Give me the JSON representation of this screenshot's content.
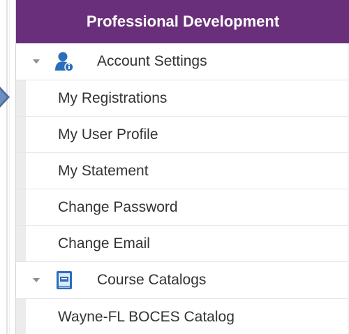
{
  "panel": {
    "title": "Professional Development"
  },
  "sections": [
    {
      "label": "Account Settings",
      "icon": "user-settings-icon",
      "items": [
        {
          "label": "My Registrations"
        },
        {
          "label": "My User Profile"
        },
        {
          "label": "My Statement"
        },
        {
          "label": "Change Password"
        },
        {
          "label": "Change Email"
        }
      ]
    },
    {
      "label": "Course Catalogs",
      "icon": "catalog-book-icon",
      "items": [
        {
          "label": "Wayne-FL BOCES Catalog"
        }
      ]
    }
  ],
  "colors": {
    "header_bg": "#6a2f7a",
    "header_text": "#ffffff",
    "pointer": "#4a6fa0",
    "user_icon": "#2a6ebb"
  }
}
